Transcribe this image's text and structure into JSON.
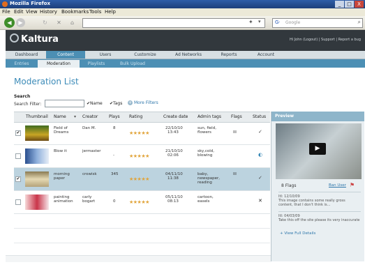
{
  "browser": {
    "title": "Mozilla Firefox",
    "menu": [
      "File",
      "Edit",
      "View",
      "History",
      "Bookmarks",
      "Tools",
      "Help"
    ],
    "search_placeholder": "Google",
    "window_controls": [
      "_",
      "□",
      "X"
    ]
  },
  "kaltura": {
    "logo": "Kaltura",
    "user_links": "Hi John (Logout)  |  Support  |  Report a bug"
  },
  "main_tabs": [
    "Dashboard",
    "Content",
    "Users",
    "Customize",
    "Ad Networks",
    "Reports",
    "Account"
  ],
  "active_main_tab": "Content",
  "sub_tabs": [
    "Entries",
    "Moderation",
    "Playlists",
    "Bulk Upload"
  ],
  "active_sub_tab": "Moderation",
  "page_title": "Moderation List",
  "search": {
    "label": "Search",
    "filter_label": "Search Filter:",
    "filter_value": "",
    "name_checkbox": "Name",
    "tags_checkbox": "Tags",
    "more_filters": "More Filters"
  },
  "table": {
    "columns": [
      "Thumbnail",
      "Name",
      "Creator",
      "Plays",
      "Rating",
      "Create date",
      "Admin tags",
      "Flags",
      "Status"
    ],
    "rows": [
      {
        "name": "Field of Dreams",
        "creator": "Dan M.",
        "plays": "8",
        "rating": "★★★★★",
        "date": "22/10/10",
        "time": "13:43",
        "tags": "sun, field, flowers",
        "flags": "III",
        "status": "✓",
        "selected": false,
        "checked": true
      },
      {
        "name": "Blow it",
        "creator": "jermaster",
        "plays": "-",
        "rating": "★★★★★",
        "date": "21/10/10",
        "time": "02:06",
        "tags": "sky,cold, blowing",
        "flags": "",
        "status": "◐",
        "selected": false,
        "checked": false
      },
      {
        "name": "morning paper",
        "creator": "crowisk",
        "plays": "345",
        "rating": "★★★★★",
        "date": "04/11/10",
        "time": "11:38",
        "tags": "baby, newspaper, reading",
        "flags": "III",
        "status": "✓",
        "selected": true,
        "checked": true
      },
      {
        "name": "painting animation",
        "creator": "carly bogart",
        "plays": "0",
        "rating": "★★★★★",
        "date": "05/11/10",
        "time": "08:13",
        "tags": "cartoon, easels",
        "flags": "",
        "status": "✕",
        "selected": false,
        "checked": false
      }
    ]
  },
  "preview": {
    "header": "Preview",
    "flags_count": "8 Flags",
    "ban_user": "Ban User",
    "flag1_title": "ItI: 12/10/09",
    "flag1_text": "This image contains some really gross content, that I don't think is...",
    "flag2_title": "ItI: 04/03/09",
    "flag2_text": "Take this off the site please its very inaccurate",
    "view_all": "+ View Full Details"
  }
}
